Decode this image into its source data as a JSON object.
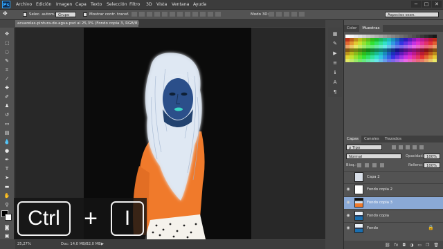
{
  "app": {
    "logo": "Ps"
  },
  "menu": [
    "Archivo",
    "Edición",
    "Imagen",
    "Capa",
    "Texto",
    "Selección",
    "Filtro",
    "3D",
    "Vista",
    "Ventana",
    "Ayuda"
  ],
  "window_controls": [
    "−",
    "□",
    "✕"
  ],
  "options_bar": {
    "auto_select_label": "Selec. autom.:",
    "auto_select_value": "Grupo",
    "transform_label": "Mostrar contr. transf.",
    "mode_3d": "Modo 3D:",
    "workspace": "Aspectos esen."
  },
  "document_tab": "acuarelas-pintura-de-agua.psd al 25,3% (Fondo copia 3, RGB/8) *",
  "status": {
    "zoom": "25,27%",
    "doc": "Doc: 14,0 MB/82,0 MB"
  },
  "shortcut": {
    "key1": "Ctrl",
    "plus": "+",
    "key2": "I"
  },
  "panels": {
    "color_tab": "Color",
    "swatches_tab": "Muestras",
    "layers_tab": "Capas",
    "channels_tab": "Canales",
    "paths_tab": "Trazados",
    "kind_filter": "ρ Tipo",
    "blend_mode": "Normal",
    "opacity_label": "Opacidad:",
    "opacity_value": "100%",
    "lock_label": "Bloq.:",
    "fill_label": "Relleno:",
    "fill_value": "100%"
  },
  "layers": [
    {
      "name": "Capa 2",
      "visible": false,
      "selected": false
    },
    {
      "name": "Fondo copia 2",
      "visible": true,
      "selected": false
    },
    {
      "name": "Fondo copia 3",
      "visible": true,
      "selected": true
    },
    {
      "name": "Fondo copia",
      "visible": true,
      "selected": false
    },
    {
      "name": "Fondo",
      "visible": true,
      "selected": false,
      "locked": true
    }
  ],
  "colors": {
    "selected_layer": "#8aa9d6",
    "photo_shirt": "#f07a2b",
    "photo_skin": "#2b4f8a"
  }
}
